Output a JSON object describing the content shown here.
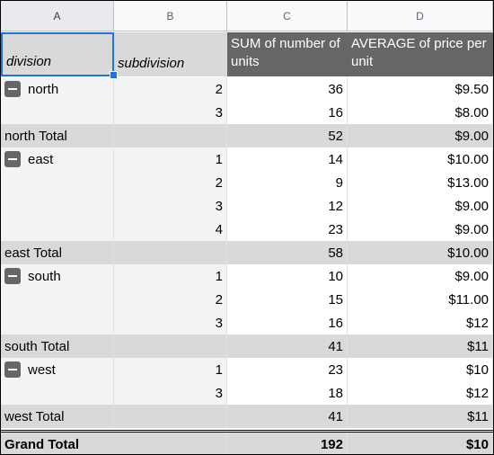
{
  "columns": [
    "A",
    "B",
    "C",
    "D"
  ],
  "headers": {
    "division": "division",
    "subdivision": "subdivision",
    "sum": "SUM of number of units",
    "avg": "AVERAGE of price per unit"
  },
  "rows": [
    {
      "type": "group",
      "division": "north",
      "sub": "2",
      "sum": "36",
      "avg": "$9.50"
    },
    {
      "type": "group",
      "division": "",
      "sub": "3",
      "sum": "16",
      "avg": "$8.00"
    },
    {
      "type": "total",
      "division": "north Total",
      "sub": "",
      "sum": "52",
      "avg": "$9.00"
    },
    {
      "type": "group",
      "division": "east",
      "sub": "1",
      "sum": "14",
      "avg": "$10.00"
    },
    {
      "type": "group",
      "division": "",
      "sub": "2",
      "sum": "9",
      "avg": "$13.00"
    },
    {
      "type": "group",
      "division": "",
      "sub": "3",
      "sum": "12",
      "avg": "$9.00"
    },
    {
      "type": "group",
      "division": "",
      "sub": "4",
      "sum": "23",
      "avg": "$9.00"
    },
    {
      "type": "total",
      "division": "east Total",
      "sub": "",
      "sum": "58",
      "avg": "$10.00"
    },
    {
      "type": "group",
      "division": "south",
      "sub": "1",
      "sum": "10",
      "avg": "$9.00"
    },
    {
      "type": "group",
      "division": "",
      "sub": "2",
      "sum": "15",
      "avg": "$11.00"
    },
    {
      "type": "group",
      "division": "",
      "sub": "3",
      "sum": "16",
      "avg": "$12"
    },
    {
      "type": "total",
      "division": "south Total",
      "sub": "",
      "sum": "41",
      "avg": "$11"
    },
    {
      "type": "group",
      "division": "west",
      "sub": "1",
      "sum": "23",
      "avg": "$10"
    },
    {
      "type": "group",
      "division": "",
      "sub": "3",
      "sum": "18",
      "avg": "$12"
    },
    {
      "type": "total",
      "division": "west Total",
      "sub": "",
      "sum": "41",
      "avg": "$11"
    }
  ],
  "grand_total": {
    "label": "Grand Total",
    "sum": "192",
    "avg": "$10"
  }
}
